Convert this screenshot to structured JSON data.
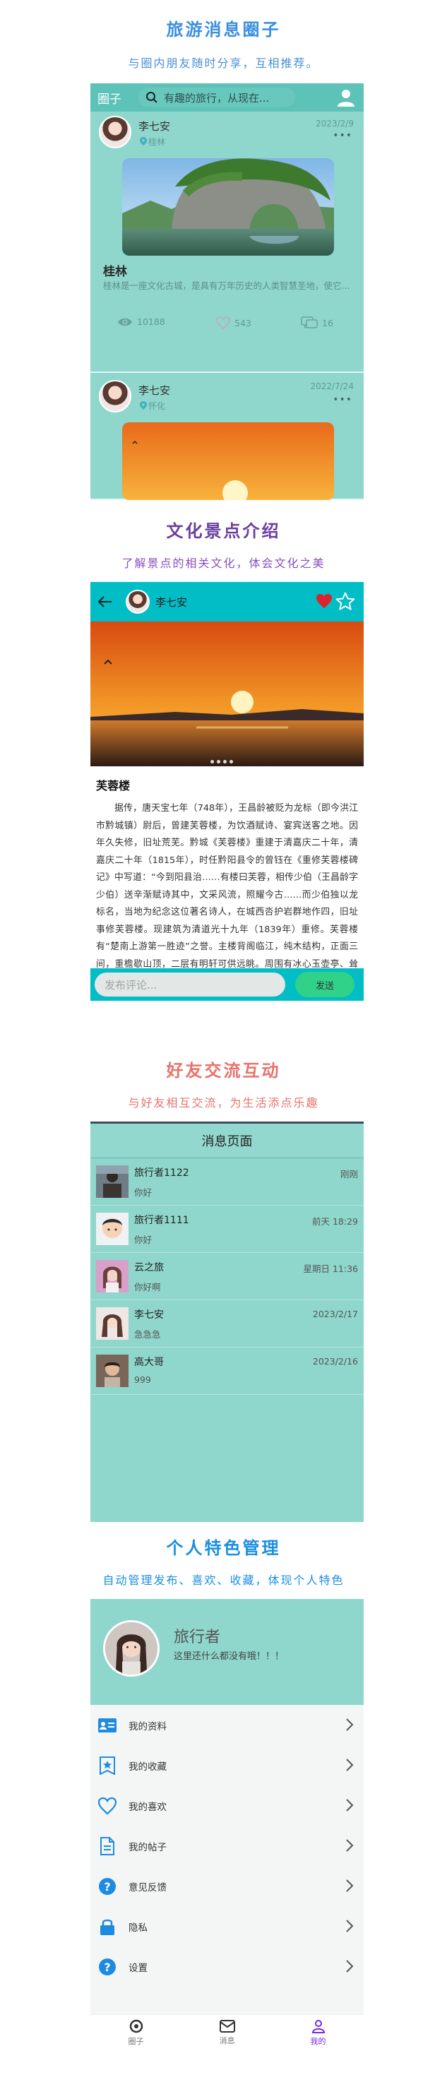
{
  "section1": {
    "title": "旅游消息圈子",
    "subtitle": "与圈内朋友随时分享，互相推荐。",
    "colors": {
      "title": "#3b8fe0",
      "subtitle": "#4a8fd8"
    },
    "app": {
      "brand": "圈子",
      "search_placeholder": "有趣的旅行，从现在...",
      "posts": [
        {
          "user": "李七安",
          "date": "2023/2/9",
          "location": "桂林",
          "more": "•••",
          "title": "桂林",
          "desc": "桂林是一座文化古城，是具有万年历史的人类智慧圣地，使它...",
          "views": "10188",
          "likes": "543",
          "comments": "16"
        },
        {
          "user": "李七安",
          "date": "2022/7/24",
          "location": "怀化",
          "more": "•••"
        }
      ]
    }
  },
  "section2": {
    "title": "文化景点介绍",
    "subtitle": "了解景点的相关文化，体会文化之美",
    "colors": {
      "title": "#6a3fa0",
      "subtitle": "#8a4fbf"
    },
    "app": {
      "author": "李七安",
      "article_title": "芙蓉楼",
      "article_body": "据传，唐天宝七年（748年），王昌龄被贬为龙标（即今洪江市黔城镇）尉后，曾建芙蓉楼，为饮酒赋诗、宴宾送客之地。因年久失修，旧址荒芜。黔城《芙蓉楼》重建于清嘉庆二十年，清嘉庆二十年（1815年），时任黔阳县令的曾钰在《重修芙蓉楼碑记》中写道：“今到阳县治……有楼曰芙蓉，相传少伯（王昌龄字少伯）送辛渐赋诗其中，文采风流，照耀今古……而少伯独以龙标名，当地为纪念这位著名诗人，在城西呇护岩群地作四，旧址事修芙蓉楼。现建筑为清道光十九年（1839年）重修。芙蓉楼有“楚南上游第一胜迹”之誉。主楼背阁临江，纯木结构，正面三间，重檐歇山顶，二层有明轩可供远眺。周围有冰心玉壶亭、耸翠楼、半月亭等古迹，与自然的山石、江水、林木巧成布局，构成了“登眺则群山拱翠，俯观则一江环流”的胜境。",
      "comment_placeholder": "发布评论...",
      "send_label": "发送"
    }
  },
  "section3": {
    "title": "好友交流互动",
    "subtitle": "与好友相互交流，为生活添点乐趣",
    "colors": {
      "title": "#e8736a",
      "subtitle": "#e8736a"
    },
    "app": {
      "header": "消息页面",
      "messages": [
        {
          "name": "旅行者1122",
          "time": "刚刚",
          "text": "你好"
        },
        {
          "name": "旅行者1111",
          "time": "前天 18:29",
          "text": "你好"
        },
        {
          "name": "云之旅",
          "time": "星期日 11:36",
          "text": "你好啊"
        },
        {
          "name": "李七安",
          "time": "2023/2/17",
          "text": "急急急"
        },
        {
          "name": "高大哥",
          "time": "2023/2/16",
          "text": "999"
        }
      ]
    }
  },
  "section4": {
    "title": "个人特色管理",
    "subtitle": "自动管理发布、喜欢、收藏，体现个人特色",
    "colors": {
      "title": "#1a8fe0",
      "subtitle": "#1a8fe0"
    },
    "app": {
      "name": "旅行者",
      "signature": "这里还什么都没有哦！！！",
      "menu": [
        {
          "label": "我的资料",
          "icon": "id-card-icon"
        },
        {
          "label": "我的收藏",
          "icon": "star-badge-icon"
        },
        {
          "label": "我的喜欢",
          "icon": "heart-icon"
        },
        {
          "label": "我的帖子",
          "icon": "document-icon"
        },
        {
          "label": "意见反馈",
          "icon": "question-icon"
        },
        {
          "label": "隐私",
          "icon": "lock-icon"
        },
        {
          "label": "设置",
          "icon": "question-icon"
        }
      ],
      "tabs": [
        {
          "label": "圈子",
          "icon": "circle-icon"
        },
        {
          "label": "消息",
          "icon": "mail-icon"
        },
        {
          "label": "我的",
          "icon": "person-icon"
        }
      ],
      "active_tab": "我的",
      "accent": "#7a2bd6"
    }
  }
}
